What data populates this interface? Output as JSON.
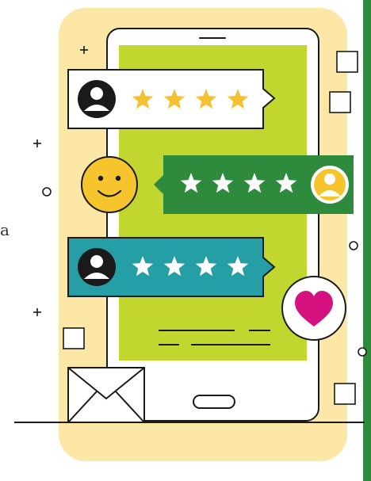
{
  "palette": {
    "background": "#ffffff",
    "frame_cream": "#fde7a6",
    "phone_screen": "#c1d72f",
    "review_dark_green": "#2e8b3e",
    "review_teal": "#259ea6",
    "star_gold": "#f6c02e",
    "smiley_yellow": "#f6c52e",
    "heart_magenta": "#d4117e",
    "edge_green": "#2e8b3e",
    "outline": "#1a1a1a"
  },
  "edge_text": "a",
  "reviews": [
    {
      "style": "white",
      "avatar": "user-avatar-icon",
      "stars": 4,
      "star_color": "gold",
      "position": "left"
    },
    {
      "style": "green",
      "avatar": "user-avatar-icon",
      "stars": 4,
      "star_color": "white",
      "position": "right"
    },
    {
      "style": "teal",
      "avatar": "user-avatar-icon",
      "stars": 4,
      "star_color": "white",
      "position": "left"
    }
  ],
  "icons": {
    "smiley": "smiley-face-icon",
    "heart": "heart-icon",
    "envelope": "envelope-icon",
    "phone": "smartphone-icon"
  }
}
